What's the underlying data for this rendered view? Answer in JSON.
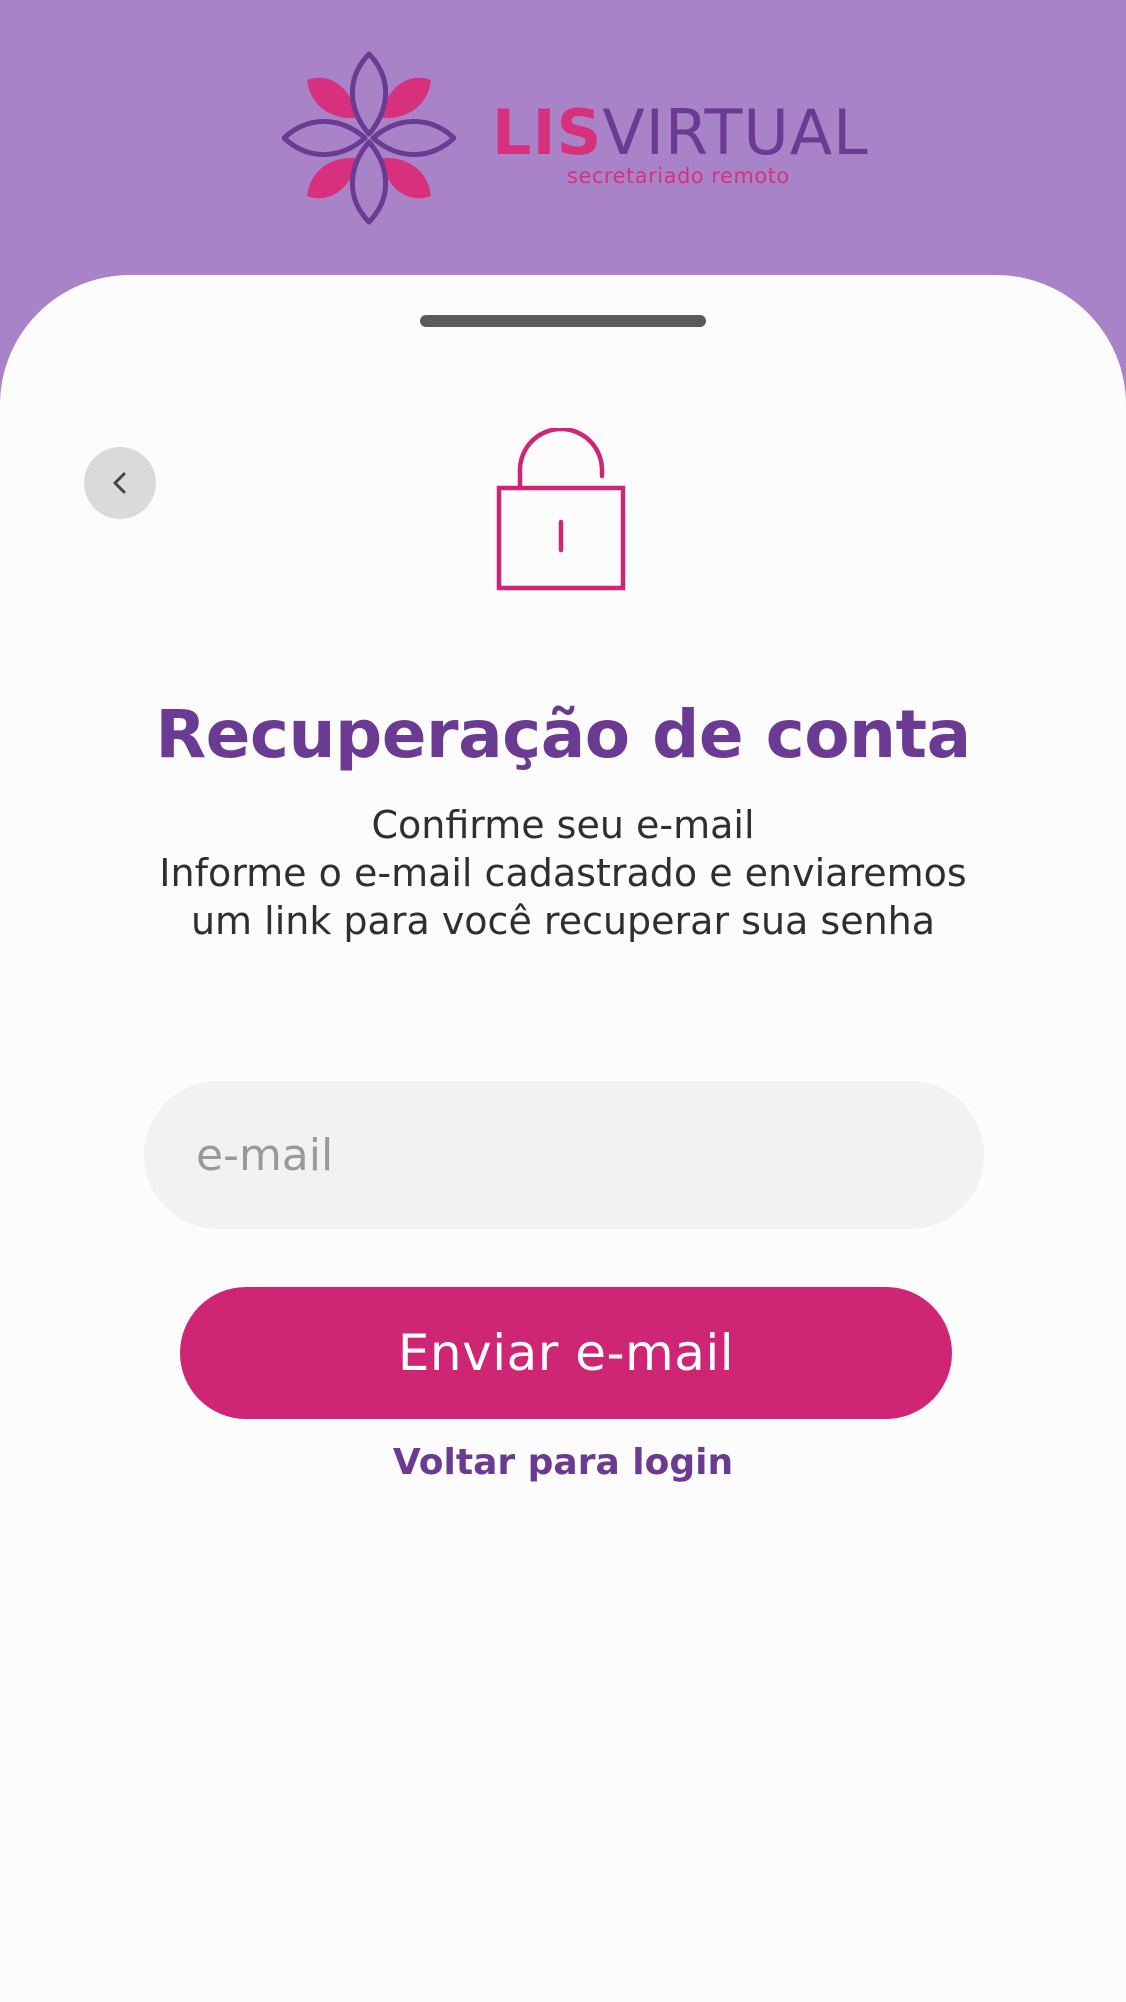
{
  "brand": {
    "name_part1": "LIS",
    "name_part2": "VIRTUAL",
    "tagline": "secretariado remoto",
    "colors": {
      "header_bg": "#a883c8",
      "pink": "#d7317e",
      "purple": "#6b3b93",
      "button": "#ce2674"
    }
  },
  "icons": {
    "back": "chevron-left-icon",
    "lock": "unlocked-padlock-icon",
    "logo": "flower-logo-icon"
  },
  "page": {
    "title": "Recuperação de conta",
    "subtitle_lines": [
      "Confirme seu e-mail",
      "Informe o e-mail cadastrado e enviaremos",
      "um link para você recuperar sua senha"
    ]
  },
  "form": {
    "email_placeholder": "e-mail",
    "email_value": "",
    "submit_label": "Enviar e-mail",
    "back_to_login_label": "Voltar para login"
  }
}
